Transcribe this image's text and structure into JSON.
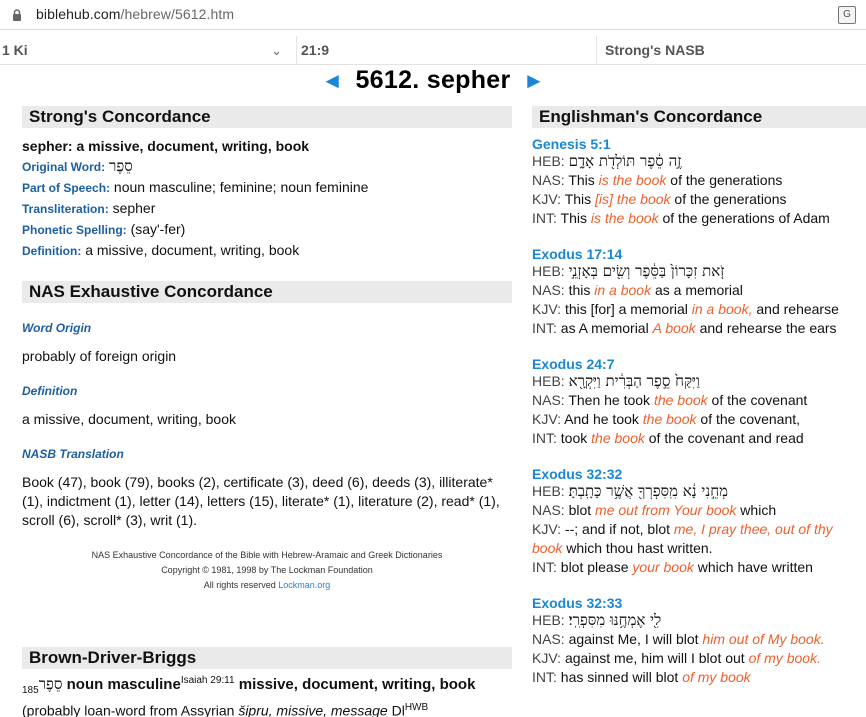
{
  "browser": {
    "url_host": "biblehub.com",
    "url_path": "/hebrew/5612.htm",
    "translate_icon": "translate-icon"
  },
  "selectors": {
    "book": "1 Ki",
    "chapter": "21:9",
    "version": "Strong's NASB"
  },
  "title": {
    "prev_arrow": "◄",
    "text": "5612. sepher",
    "next_arrow": "►"
  },
  "strongs": {
    "heading": "Strong's Concordance",
    "def": "sepher: a missive, document, writing, book",
    "original_word_label": "Original Word:",
    "original_word": "סֵפֶר",
    "pos_label": "Part of Speech:",
    "pos": "noun masculine; feminine; noun feminine",
    "translit_label": "Transliteration:",
    "translit": "sepher",
    "phonetic_label": "Phonetic Spelling:",
    "phonetic": "(say'-fer)",
    "definition_label": "Definition:",
    "definition": "a missive, document, writing, book"
  },
  "nas": {
    "heading": "NAS Exhaustive Concordance",
    "word_origin_label": "Word Origin",
    "word_origin": "probably of foreign origin",
    "definition_label": "Definition",
    "definition": "a missive, document, writing, book",
    "translation_label": "NASB Translation",
    "translation": "Book (47), book (79), books (2), certificate (3), deed (6), deeds (3), illiterate* (1), indictment (1), letter (14), letters (15), literate* (1), literature (2), read* (1), scroll (6), scroll* (3), writ (1).",
    "credit1": "NAS Exhaustive Concordance of the Bible with Hebrew-Aramaic and Greek Dictionaries",
    "credit2": "Copyright © 1981, 1998 by The Lockman Foundation",
    "credit3_pre": "All rights reserved ",
    "credit3_link": "Lockman.org"
  },
  "bdb": {
    "heading": "Brown-Driver-Briggs",
    "num": "185",
    "word": "סֵפֶר",
    "pos": " noun masculine",
    "ref_sup": "Isaiah 29:11",
    "meaning": " missive, document, writing, book",
    "line2_pre": "(probably loan-word from Assyrian ",
    "line2_it": "šipru, missive, message",
    "line2_post": " Dl",
    "line2_sup": "HWB"
  },
  "englishman": {
    "heading": "Englishman's Concordance",
    "entries": [
      {
        "ref": "Genesis 5:1",
        "heb_label": "HEB:",
        "heb": "זֶ֣ה סֵ֔פֶר תּוֹלְדֹ֖ת אָדָ֑ם",
        "nas_label": "NAS:",
        "nas_pre": "This ",
        "nas_hl": "is the book",
        "nas_post": " of the generations",
        "kjv_label": "KJV:",
        "kjv_pre": "This ",
        "kjv_hl": "[is] the book",
        "kjv_post": " of the generations",
        "kjv2": "",
        "int_label": "INT:",
        "int_pre": "This ",
        "int_hl": "is the book",
        "int_post": " of the generations of Adam"
      },
      {
        "ref": "Exodus 17:14",
        "heb_label": "HEB:",
        "heb": "זֹ֤את זִכָּרוֹן֙ בַּסֵּ֔פֶר וְשִׂ֖ים בְּאָזְנֵ֣י",
        "nas_label": "NAS:",
        "nas_pre": "this ",
        "nas_hl": "in a book",
        "nas_post": " as a memorial",
        "kjv_label": "KJV:",
        "kjv_pre": "this [for] a memorial ",
        "kjv_hl": "in a book,",
        "kjv_post": " and rehearse",
        "kjv2": "",
        "int_label": "INT:",
        "int_pre": "as A memorial ",
        "int_hl": "A book",
        "int_post": " and rehearse the ears"
      },
      {
        "ref": "Exodus 24:7",
        "heb_label": "HEB:",
        "heb": "וַיִּקַּח֙ סֵ֣פֶר הַבְּרִ֔ית וַיִּקְרָ֖א",
        "nas_label": "NAS:",
        "nas_pre": "Then he took ",
        "nas_hl": "the book",
        "nas_post": " of the covenant",
        "kjv_label": "KJV:",
        "kjv_pre": "And he took ",
        "kjv_hl": "the book",
        "kjv_post": " of the covenant,",
        "kjv2": "",
        "int_label": "INT:",
        "int_pre": "took ",
        "int_hl": "the book",
        "int_post": " of the covenant and read"
      },
      {
        "ref": "Exodus 32:32",
        "heb_label": "HEB:",
        "heb": "מְחֵ֣נִי נָ֔א מִֽסִּפְרְךָ֖ אֲשֶׁ֥ר כָּתָֽבְתָּ׃",
        "nas_label": "NAS:",
        "nas_pre": "blot ",
        "nas_hl": "me out from Your book",
        "nas_post": " which",
        "kjv_label": "KJV:",
        "kjv_pre": "--; and if not, blot ",
        "kjv_hl": "me, I pray thee, out of thy",
        "kjv_post": "",
        "kjv2_hl": "book",
        "kjv2": " which thou hast written.",
        "int_label": "INT:",
        "int_pre": "blot please ",
        "int_hl": "your book",
        "int_post": " which have written"
      },
      {
        "ref": "Exodus 32:33",
        "heb_label": "HEB:",
        "heb": "לִ֖י אֶמְחֶ֥נּוּ מִסִּפְרִֽי׃",
        "nas_label": "NAS:",
        "nas_pre": "against Me, I will blot ",
        "nas_hl": "him out of My book.",
        "nas_post": "",
        "kjv_label": "KJV:",
        "kjv_pre": "against me, him will I blot out ",
        "kjv_hl": "of my book.",
        "kjv_post": "",
        "kjv2": "",
        "int_label": "INT:",
        "int_pre": "has sinned will blot ",
        "int_hl": "of my book",
        "int_post": ""
      }
    ]
  }
}
